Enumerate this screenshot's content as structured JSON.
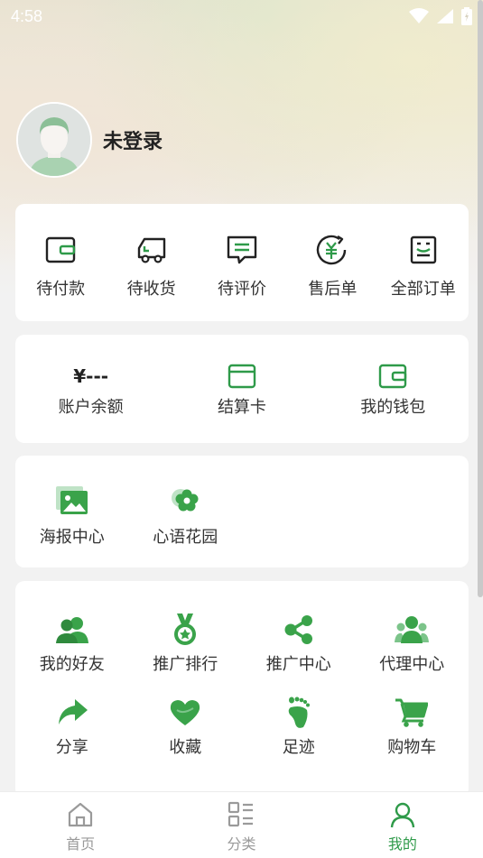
{
  "status_bar": {
    "time": "4:58"
  },
  "profile": {
    "name": "未登录"
  },
  "orders": {
    "items": [
      {
        "label": "待付款",
        "icon": "wallet-icon"
      },
      {
        "label": "待收货",
        "icon": "truck-icon"
      },
      {
        "label": "待评价",
        "icon": "comment-icon"
      },
      {
        "label": "售后单",
        "icon": "refund-icon"
      },
      {
        "label": "全部订单",
        "icon": "orders-icon"
      }
    ]
  },
  "wallet": {
    "balance_value": "¥---",
    "balance_label": "账户余额",
    "card_label": "结算卡",
    "purse_label": "我的钱包"
  },
  "tools": {
    "items": [
      {
        "label": "海报中心",
        "icon": "picture-icon"
      },
      {
        "label": "心语花园",
        "icon": "flower-icon"
      }
    ]
  },
  "services": {
    "items": [
      {
        "label": "我的好友",
        "icon": "friends-icon"
      },
      {
        "label": "推广排行",
        "icon": "medal-icon"
      },
      {
        "label": "推广中心",
        "icon": "share-nodes-icon"
      },
      {
        "label": "代理中心",
        "icon": "agents-icon"
      },
      {
        "label": "分享",
        "icon": "forward-arrow-icon"
      },
      {
        "label": "收藏",
        "icon": "heart-icon"
      },
      {
        "label": "足迹",
        "icon": "footprint-icon"
      },
      {
        "label": "购物车",
        "icon": "cart-icon"
      }
    ]
  },
  "tabbar": {
    "tabs": [
      {
        "label": "首页",
        "icon": "home-icon",
        "active": false
      },
      {
        "label": "分类",
        "icon": "category-icon",
        "active": false
      },
      {
        "label": "我的",
        "icon": "user-icon",
        "active": true
      }
    ]
  },
  "colors": {
    "accent": "#2e9a49",
    "icon_green": "#3aa34a",
    "inactive": "#9a9a9a"
  }
}
